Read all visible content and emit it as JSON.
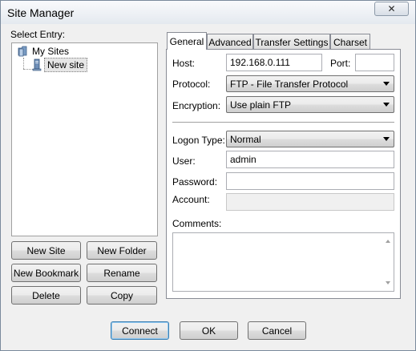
{
  "window": {
    "title": "Site Manager",
    "close_glyph": "✕"
  },
  "left": {
    "select_entry_label": "Select Entry:",
    "tree": {
      "root": "My Sites",
      "child": "New site"
    },
    "buttons": {
      "new_site": "New Site",
      "new_folder": "New Folder",
      "new_bookmark": "New Bookmark",
      "rename": "Rename",
      "delete": "Delete",
      "copy": "Copy"
    }
  },
  "tabs": [
    "General",
    "Advanced",
    "Transfer Settings",
    "Charset"
  ],
  "general": {
    "host_label": "Host:",
    "host_value": "192.168.0.111",
    "port_label": "Port:",
    "port_value": "",
    "protocol_label": "Protocol:",
    "protocol_value": "FTP - File Transfer Protocol",
    "encryption_label": "Encryption:",
    "encryption_value": "Use plain FTP",
    "logon_type_label": "Logon Type:",
    "logon_type_value": "Normal",
    "user_label": "User:",
    "user_value": "admin",
    "password_label": "Password:",
    "password_value": "",
    "account_label": "Account:",
    "account_value": "",
    "comments_label": "Comments:",
    "comments_value": ""
  },
  "footer": {
    "connect": "Connect",
    "ok": "OK",
    "cancel": "Cancel"
  },
  "icons": {
    "folder": "folder-icon",
    "site": "computer-icon"
  }
}
